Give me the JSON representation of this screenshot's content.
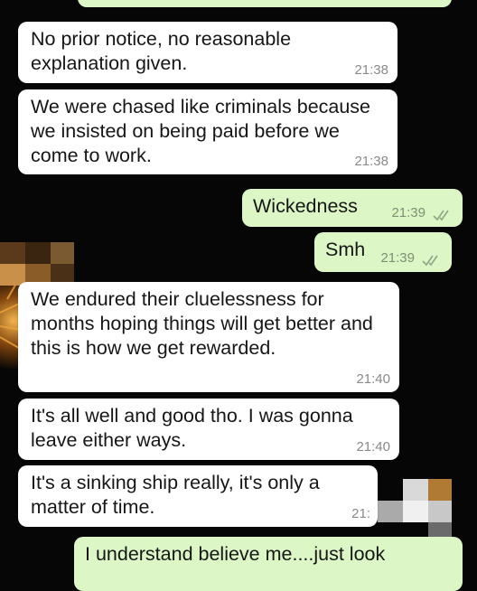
{
  "theme": {
    "incoming_bubble": "#ffffff",
    "outgoing_bubble": "#dcf7c5",
    "background": "#070606",
    "timestamp_color": "#8a8a8a"
  },
  "messages": [
    {
      "direction": "in",
      "text": "No prior notice, no reasonable explanation given.",
      "time": "21:38"
    },
    {
      "direction": "in",
      "text": "We were chased like criminals because we insisted on being paid before we come to work.",
      "time": "21:38"
    },
    {
      "direction": "out",
      "text": "Wickedness",
      "time": "21:39",
      "status": "read-double-check-icon"
    },
    {
      "direction": "out",
      "text": "Smh",
      "time": "21:39",
      "status": "read-double-check-icon"
    },
    {
      "direction": "in",
      "text": "We endured their cluelessness for months hoping things will get better and this is how we get rewarded.",
      "time": "21:40"
    },
    {
      "direction": "in",
      "text": "It's all well and good tho. I was gonna leave either ways.",
      "time": "21:40"
    },
    {
      "direction": "in",
      "text": "It's a sinking ship really, it's only a matter of time.",
      "time": "21:"
    },
    {
      "direction": "out",
      "text": "I understand believe me....just look",
      "time": ""
    }
  ]
}
